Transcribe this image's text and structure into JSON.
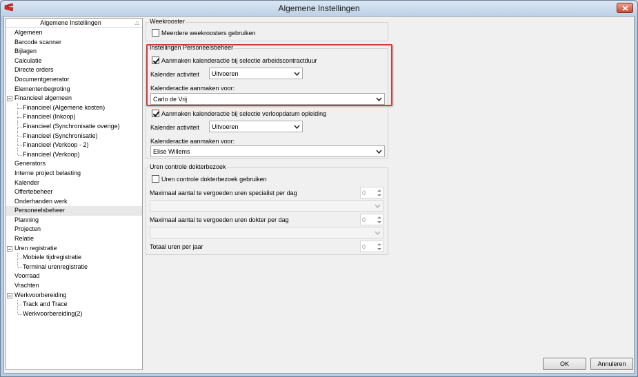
{
  "window": {
    "title": "Algemene Instellingen"
  },
  "tree": {
    "header": "Algemene Instellingen",
    "items": [
      {
        "label": "Algemeen",
        "level": 0
      },
      {
        "label": "Barcode scanner",
        "level": 0
      },
      {
        "label": "Bijlagen",
        "level": 0
      },
      {
        "label": "Calculatie",
        "level": 0
      },
      {
        "label": "Directe orders",
        "level": 0
      },
      {
        "label": "Documentgenerator",
        "level": 0
      },
      {
        "label": "Elementenbegroting",
        "level": 0
      },
      {
        "label": "Financieel algemeen",
        "level": 0,
        "expanded": true
      },
      {
        "label": "Financieel (Algemene kosten)",
        "level": 1
      },
      {
        "label": "Financieel (Inkoop)",
        "level": 1
      },
      {
        "label": "Financieel (Synchronisatie overige)",
        "level": 1
      },
      {
        "label": "Financieel (Synchronisatie)",
        "level": 1
      },
      {
        "label": "Financieel (Verkoop - 2)",
        "level": 1
      },
      {
        "label": "Financieel (Verkoop)",
        "level": 1
      },
      {
        "label": "Generators",
        "level": 0
      },
      {
        "label": "Interne project belasting",
        "level": 0
      },
      {
        "label": "Kalender",
        "level": 0
      },
      {
        "label": "Offertebeheer",
        "level": 0
      },
      {
        "label": "Onderhanden werk",
        "level": 0
      },
      {
        "label": "Personeelsbeheer",
        "level": 0,
        "selected": true
      },
      {
        "label": "Planning",
        "level": 0
      },
      {
        "label": "Projecten",
        "level": 0
      },
      {
        "label": "Relatie",
        "level": 0
      },
      {
        "label": "Uren registratie",
        "level": 0,
        "expanded": true
      },
      {
        "label": "Mobiele tijdregistratie",
        "level": 1
      },
      {
        "label": "Terminal urenregistratie",
        "level": 1
      },
      {
        "label": "Voorraad",
        "level": 0
      },
      {
        "label": "Vrachten",
        "level": 0
      },
      {
        "label": "Werkvoorbereiding",
        "level": 0,
        "expanded": true
      },
      {
        "label": "Track and Trace",
        "level": 1
      },
      {
        "label": "Werkvoorbereiding(2)",
        "level": 1
      }
    ]
  },
  "weekrooster": {
    "title": "Weekrooster",
    "multiple_label": "Meerdere weekroosters gebruiken",
    "multiple_checked": false
  },
  "personeelsbeheer": {
    "title": "Instellingen Personeelsbeheer",
    "contract_label": "Aanmaken kalenderactie bij selectie arbeidscontractduur",
    "contract_checked": true,
    "activity_label": "Kalender activiteit",
    "activity_value": "Uitvoeren",
    "create_for_label": "Kalenderactie aanmaken voor:",
    "create_for_value": "Carlo de Vrij",
    "training_label": "Aanmaken kalenderactie bij selectie verloopdatum opleiding",
    "training_checked": true,
    "activity2_label": "Kalender activiteit",
    "activity2_value": "Uitvoeren",
    "create_for2_label": "Kalenderactie aanmaken voor:",
    "create_for2_value": "Elise Willems"
  },
  "uren_controle": {
    "title": "Uren controle dokterbezoek",
    "use_label": "Uren controle dokterbezoek gebruiken",
    "use_checked": false,
    "specialist_label": "Maximaal aantal te vergoeden uren specialist per dag",
    "specialist_value": "0",
    "doctor_label": "Maximaal aantal te vergoeden uren dokter per dag",
    "doctor_value": "0",
    "total_label": "Totaal uren per jaar",
    "total_value": "0"
  },
  "buttons": {
    "ok": "OK",
    "cancel": "Annuleren"
  },
  "colors": {
    "highlight": "#d9383a",
    "titlebar": "#bed1e6",
    "close": "#c74a32"
  }
}
